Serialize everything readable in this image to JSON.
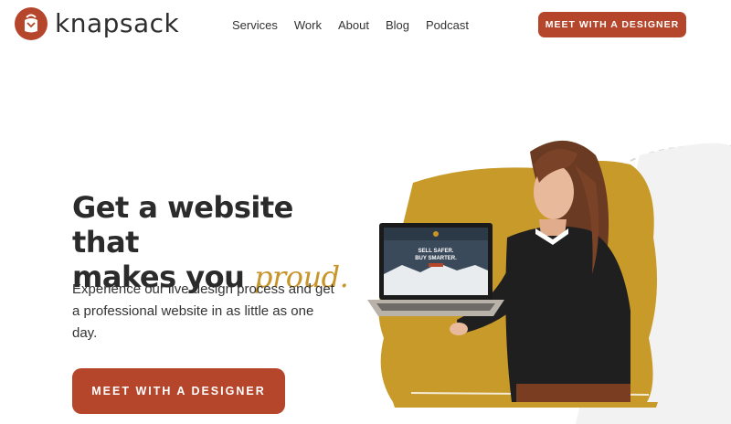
{
  "brand": {
    "name": "knapsack",
    "accent": "#b5462b",
    "gold": "#c8952a"
  },
  "nav": {
    "items": [
      {
        "label": "Services"
      },
      {
        "label": "Work"
      },
      {
        "label": "About"
      },
      {
        "label": "Blog"
      },
      {
        "label": "Podcast"
      }
    ],
    "cta_label": "MEET WITH A DESIGNER"
  },
  "hero": {
    "title_line1": "Get a website that",
    "title_line2_prefix": "makes you ",
    "title_accent": "proud.",
    "subtitle": "Experience our live design process and get a professional website in as little as one day.",
    "cta_label": "MEET WITH A DESIGNER"
  },
  "laptop_screen": {
    "headline_line1": "SELL SAFER.",
    "headline_line2": "BUY SMARTER."
  },
  "icons": {
    "logo": "backpack-icon"
  }
}
